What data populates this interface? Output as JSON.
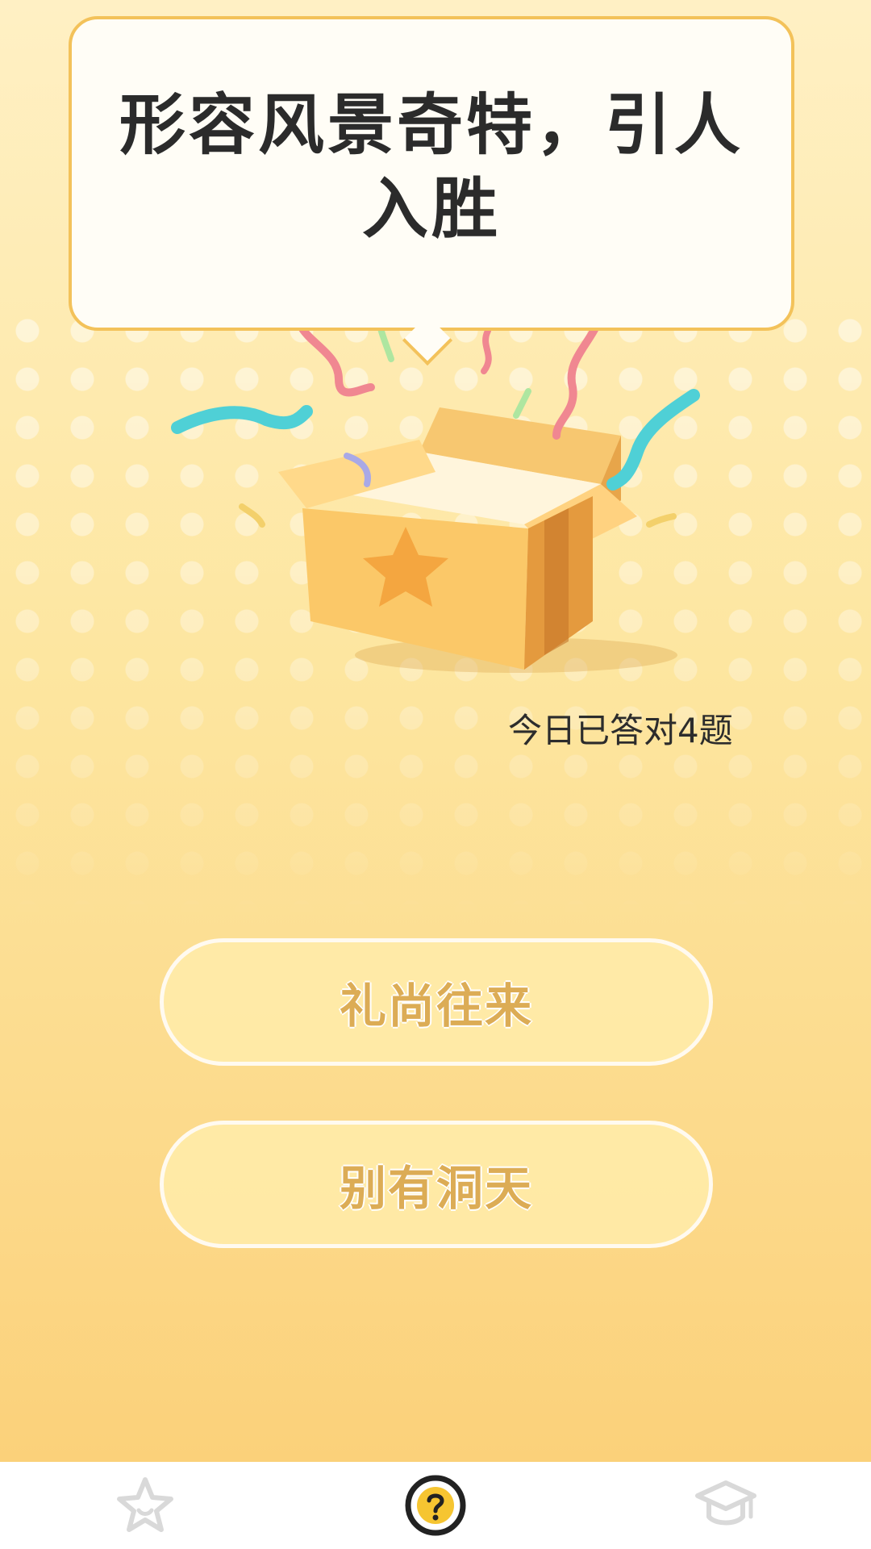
{
  "quiz": {
    "question": "形容风景奇特，引人入胜",
    "progress_text": "今日已答对4题",
    "options": [
      {
        "label": "礼尚往来"
      },
      {
        "label": "别有洞天"
      }
    ]
  },
  "tabs": [
    {
      "icon": "star-icon",
      "active": false
    },
    {
      "icon": "question-icon",
      "active": true
    },
    {
      "icon": "graduation-cap-icon",
      "active": false
    }
  ],
  "colors": {
    "accent": "#f3c25a",
    "option_text": "#dcac55",
    "active_tab": "#222222",
    "inactive_tab": "#d9d9d9"
  }
}
